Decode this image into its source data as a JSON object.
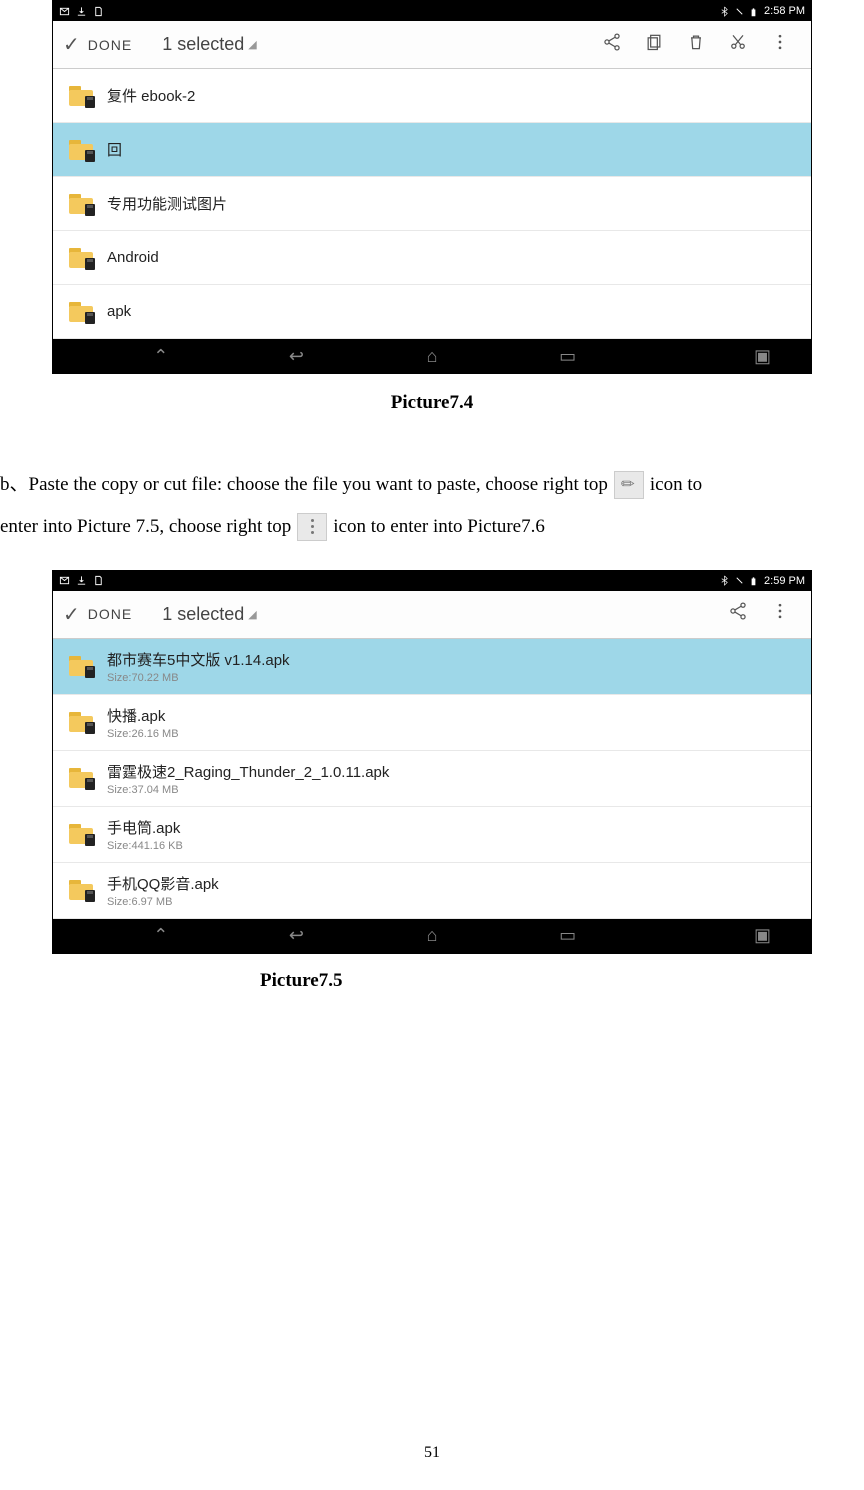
{
  "shot1": {
    "status_time": "2:58 PM",
    "actionbar": {
      "done": "DONE",
      "selected": "1 selected"
    },
    "items": [
      {
        "name": "复件 ebook-2",
        "sub": "",
        "sel": false
      },
      {
        "name": "回",
        "sub": "",
        "sel": true
      },
      {
        "name": "专用功能测试图片",
        "sub": "",
        "sel": false
      },
      {
        "name": "Android",
        "sub": "",
        "sel": false
      },
      {
        "name": "apk",
        "sub": "",
        "sel": false
      }
    ]
  },
  "caption1": "Picture7.4",
  "para_b_1": "b、Paste the copy or cut file: choose the file you want to paste, choose right top",
  "para_b_2": "icon to",
  "para_b_3": "enter into Picture 7.5, choose right top",
  "para_b_4": "icon to enter into Picture7.6",
  "shot2": {
    "status_time": "2:59 PM",
    "actionbar": {
      "done": "DONE",
      "selected": "1 selected"
    },
    "items": [
      {
        "name": "都市赛车5中文版 v1.14.apk",
        "sub": "Size:70.22 MB",
        "sel": true
      },
      {
        "name": "快播.apk",
        "sub": "Size:26.16 MB",
        "sel": false
      },
      {
        "name": "雷霆极速2_Raging_Thunder_2_1.0.11.apk",
        "sub": "Size:37.04 MB",
        "sel": false
      },
      {
        "name": "手电筒.apk",
        "sub": "Size:441.16 KB",
        "sel": false
      },
      {
        "name": "手机QQ影音.apk",
        "sub": "Size:6.97 MB",
        "sel": false
      }
    ]
  },
  "caption2": "Picture7.5",
  "page_number": "51"
}
